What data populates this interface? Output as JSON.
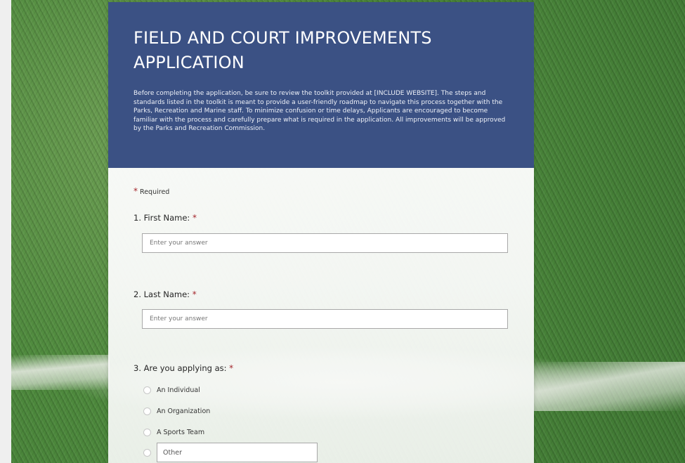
{
  "form": {
    "title": "FIELD AND COURT IMPROVEMENTS APPLICATION",
    "description": "Before completing the application, be sure to review the toolkit provided at [INCLUDE WEBSITE]. The steps and standards listed in the toolkit is meant to provide a user-friendly roadmap to navigate this process together with the Parks, Recreation and Marine staff. To minimize confusion or time delays, Applicants are encouraged to become familiar with the process and carefully prepare what is required in the application. All improvements will be approved by the Parks and Recreation Commission.",
    "required_star": "*",
    "required_note": "Required"
  },
  "questions": [
    {
      "label": "1. First Name:",
      "star": "*",
      "placeholder": "Enter your answer"
    },
    {
      "label": "2. Last Name:",
      "star": "*",
      "placeholder": "Enter your answer"
    },
    {
      "label": "3. Are you applying as:",
      "star": "*",
      "options": [
        "An Individual",
        "An Organization",
        "A Sports Team"
      ],
      "other_placeholder": "Other"
    }
  ],
  "colors": {
    "header_bg": "#3b5184",
    "required_star": "#a4262c"
  }
}
